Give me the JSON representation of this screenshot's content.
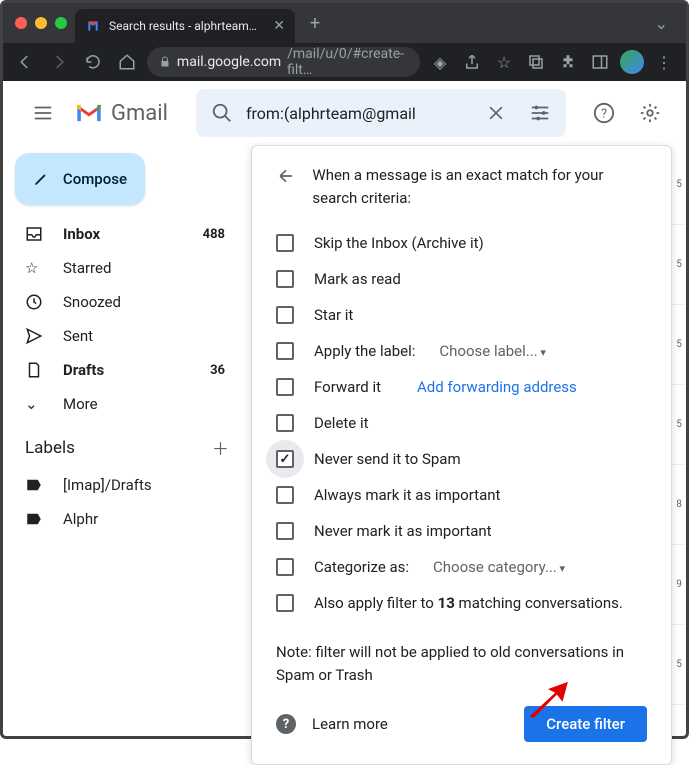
{
  "browser": {
    "tab_title": "Search results - alphrteam@…",
    "url_domain": "mail.google.com",
    "url_path": "/mail/u/0/#create-filt…"
  },
  "header": {
    "app_name": "Gmail",
    "search_value": "from:(alphrteam@gmail"
  },
  "sidebar": {
    "compose": "Compose",
    "items": [
      {
        "label": "Inbox",
        "count": "488",
        "bold": true
      },
      {
        "label": "Starred"
      },
      {
        "label": "Snoozed"
      },
      {
        "label": "Sent"
      },
      {
        "label": "Drafts",
        "count": "36",
        "bold": true
      },
      {
        "label": "More"
      }
    ],
    "labels_heading": "Labels",
    "labels": [
      {
        "label": "[Imap]/Drafts"
      },
      {
        "label": "Alphr"
      }
    ]
  },
  "filter_panel": {
    "heading": "When a message is an exact match for your search criteria:",
    "options": {
      "skip_inbox": "Skip the Inbox (Archive it)",
      "mark_read": "Mark as read",
      "star_it": "Star it",
      "apply_label": "Apply the label:",
      "apply_label_dropdown": "Choose label...",
      "forward_it": "Forward it",
      "forward_link": "Add forwarding address",
      "delete_it": "Delete it",
      "never_spam": "Never send it to Spam",
      "always_important": "Always mark it as important",
      "never_important": "Never mark it as important",
      "categorize": "Categorize as:",
      "categorize_dropdown": "Choose category...",
      "also_apply_pre": "Also apply filter to ",
      "also_apply_count": "13",
      "also_apply_post": " matching conversations."
    },
    "note": "Note: filter will not be applied to old conversations in Spam or Trash",
    "learn_more": "Learn more",
    "create_button": "Create filter"
  },
  "bg_numbers": [
    "5",
    "5",
    "5",
    "5",
    "8",
    "9",
    "5"
  ]
}
